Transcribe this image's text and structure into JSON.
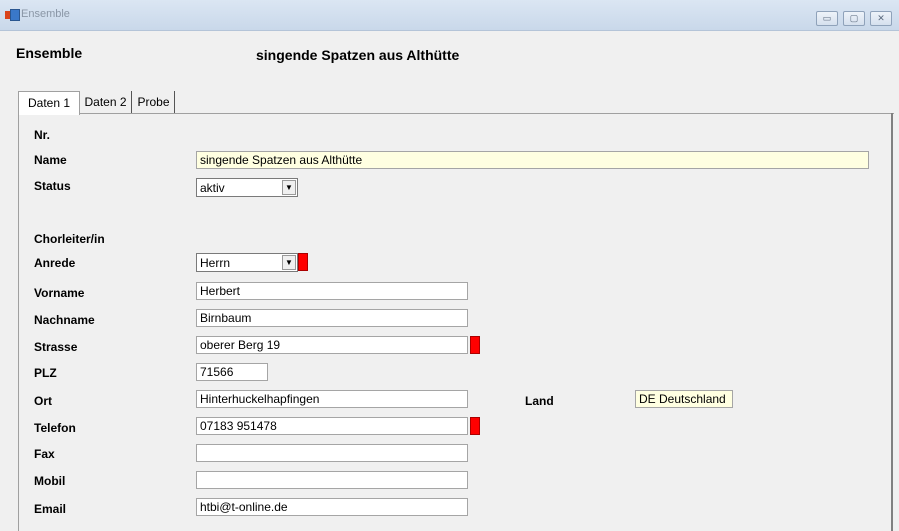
{
  "window": {
    "title": "Ensemble",
    "min_glyph": "▭",
    "max_glyph": "▢",
    "close_glyph": "✕"
  },
  "header": {
    "title": "Ensemble",
    "ensemble_name": "singende Spatzen aus Althütte"
  },
  "tabs": [
    "Daten 1",
    "Daten 2",
    "Probe"
  ],
  "active_tab": "Daten 1",
  "form": {
    "nr_label": "Nr.",
    "name_label": "Name",
    "name_value": "singende Spatzen aus Althütte",
    "status_label": "Status",
    "status_value": "aktiv",
    "section_label": "Chorleiter/in",
    "anrede_label": "Anrede",
    "anrede_value": "Herrn",
    "vorname_label": "Vorname",
    "vorname_value": "Herbert",
    "nachname_label": "Nachname",
    "nachname_value": "Birnbaum",
    "strasse_label": "Strasse",
    "strasse_value": "oberer Berg 19",
    "plz_label": "PLZ",
    "plz_value": "71566",
    "ort_label": "Ort",
    "ort_value": "Hinterhuckelhapfingen",
    "land_label": "Land",
    "land_value": "DE Deutschland",
    "telefon_label": "Telefon",
    "telefon_value": "07183 951478",
    "fax_label": "Fax",
    "fax_value": "",
    "mobil_label": "Mobil",
    "mobil_value": "",
    "email_label": "Email",
    "email_value": "htbi@t-online.de"
  },
  "colors": {
    "required_marker": "#ff0000",
    "highlight_field": "#ffffe1"
  },
  "icons": {
    "dropdown": "chevron-down-icon",
    "app": "app-icon"
  },
  "dropdown_glyph": "▼"
}
